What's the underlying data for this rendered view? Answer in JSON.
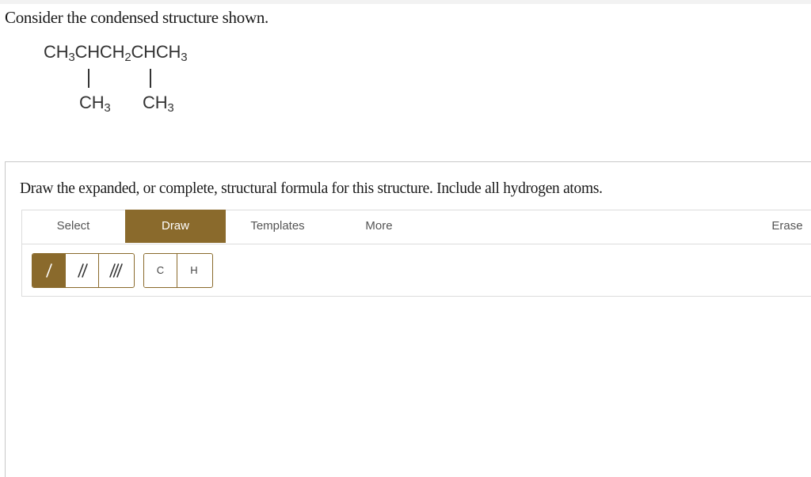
{
  "question": {
    "text": "Consider the condensed structure shown."
  },
  "structure": {
    "main_chain": {
      "part1": "CH",
      "sub1": "3",
      "part2": "CHCH",
      "sub2": "2",
      "part3": "CHCH",
      "sub3": "3"
    },
    "branches": [
      {
        "label": "CH",
        "sub": "3"
      },
      {
        "label": "CH",
        "sub": "3"
      }
    ]
  },
  "panel": {
    "instructions": "Draw the expanded, or complete, structural formula for this structure. Include all hydrogen atoms."
  },
  "toolbar": {
    "tabs": [
      {
        "label": "Select",
        "active": false
      },
      {
        "label": "Draw",
        "active": true
      },
      {
        "label": "Templates",
        "active": false
      },
      {
        "label": "More",
        "active": false
      }
    ],
    "erase_label": "Erase",
    "accent_color": "#8a6a2c"
  },
  "tools": {
    "bonds": [
      {
        "icon": "single-bond-icon",
        "active": true
      },
      {
        "icon": "double-bond-icon",
        "active": false
      },
      {
        "icon": "triple-bond-icon",
        "active": false
      }
    ],
    "atoms": [
      {
        "label": "C"
      },
      {
        "label": "H"
      }
    ]
  }
}
